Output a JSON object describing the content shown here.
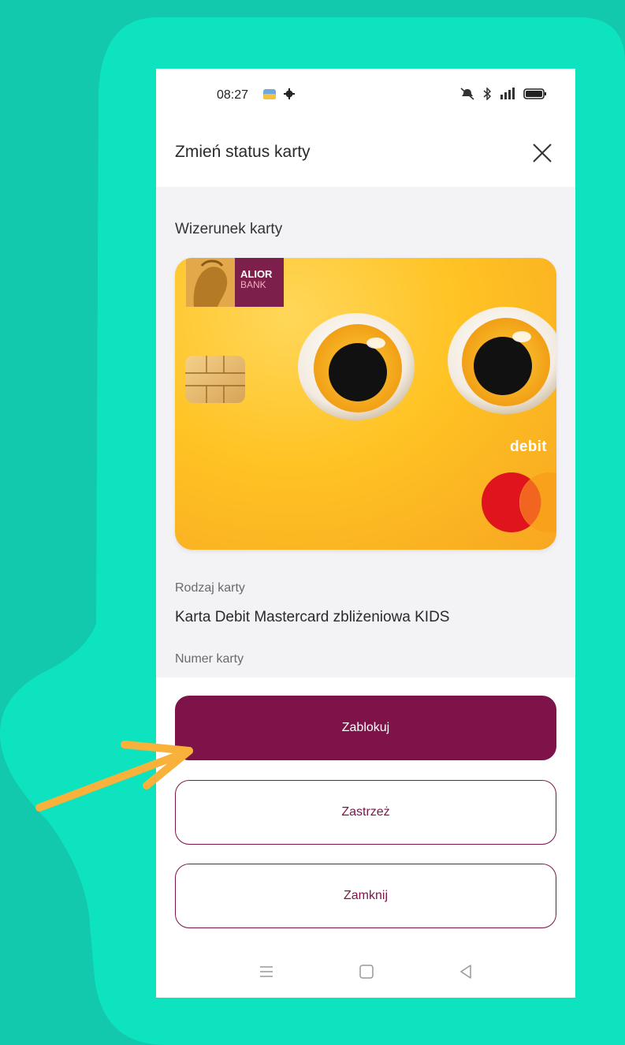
{
  "colors": {
    "background": "#12c9ae",
    "panel": "#0ee3c0",
    "brand": "#7d1349",
    "arrow": "#f8b13a"
  },
  "status_bar": {
    "time": "08:27",
    "icons": [
      "app-notification-icon",
      "gear-icon",
      "mute-icon",
      "bluetooth-icon",
      "signal-icon",
      "battery-icon"
    ]
  },
  "header": {
    "title": "Zmień status karty",
    "close_icon": "close-icon"
  },
  "card_image": {
    "section_label": "Wizerunek karty",
    "bank_name_line1": "ALIOR",
    "bank_name_line2": "BANK",
    "card_label": "debit",
    "network": "Mastercard"
  },
  "card_details": {
    "type_label": "Rodzaj karty",
    "type_value": "Karta Debit Mastercard zbliżeniowa KIDS",
    "number_label": "Numer karty"
  },
  "actions": {
    "block_label": "Zablokuj",
    "restrict_label": "Zastrzeż",
    "close_label": "Zamknij"
  },
  "nav_bar": {
    "icons": [
      "menu-icon",
      "home-icon",
      "back-icon"
    ]
  }
}
